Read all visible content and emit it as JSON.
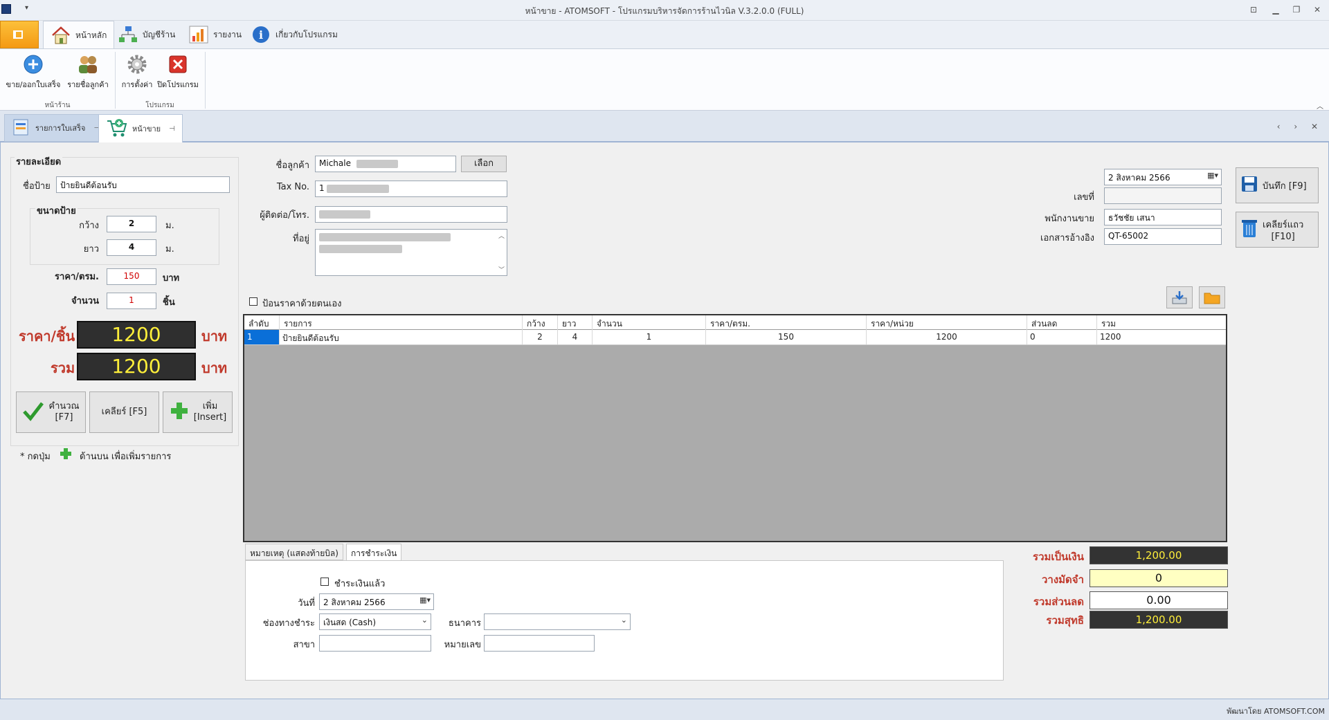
{
  "window": {
    "title": "หน้าขาย - ATOMSOFT - โปรแกรมบริหารจัดการร้านไวนิล V.3.2.0.0 (FULL)"
  },
  "ribbon": {
    "tabs": [
      {
        "label": "หน้าหลัก",
        "icon": "home-icon"
      },
      {
        "label": "บัญชีร้าน",
        "icon": "network-icon"
      },
      {
        "label": "รายงาน",
        "icon": "chart-icon"
      },
      {
        "label": "เกี่ยวกับโปรแกรม",
        "icon": "info-icon"
      }
    ],
    "buttons": {
      "sell": "ขาย/ออกใบเสร็จ",
      "customers": "รายชื่อลูกค้า",
      "settings": "การตั้งค่า",
      "close": "ปิดโปรแกรม"
    },
    "groups": {
      "shop": "หน้าร้าน",
      "program": "โปรแกรม"
    }
  },
  "doc_tabs": [
    {
      "label": "รายการใบเสร็จ"
    },
    {
      "label": "หน้าขาย"
    }
  ],
  "details": {
    "group_title": "รายละเอียด",
    "sign_name_label": "ชื่อป้าย",
    "sign_name": "ป้ายยินดีต้อนรับ",
    "size_title": "ขนาดป้าย",
    "width_label": "กว้าง",
    "width": "2",
    "length_label": "ยาว",
    "length": "4",
    "unit_m": "ม.",
    "price_sqm_label": "ราคา/ตรม.",
    "price_sqm": "150",
    "baht": "บาท",
    "qty_label": "จำนวน",
    "qty": "1",
    "pieces": "ชิ้น",
    "price_per_piece_label": "ราคา/ชิ้น",
    "price_per_piece": "1200",
    "total_label": "รวม",
    "total": "1200",
    "baht_big": "บาท",
    "btn_calc": "คำนวณ\n[F7]",
    "btn_clear": "เคลียร์ [F5]",
    "btn_add": "เพิ่ม\n[Insert]",
    "hint_prefix": "* กดปุ่ม",
    "hint_suffix": "ด้านบน เพื่อเพิ่มรายการ"
  },
  "customer": {
    "name_label": "ชื่อลูกค้า",
    "name": "Michale",
    "choose_btn": "เลือก",
    "tax_label": "Tax No.",
    "tax": "1",
    "contact_label": "ผู้ติดต่อ/โทร.",
    "address_label": "ที่อยู่"
  },
  "doc": {
    "date": "2   สิงหาคม     2566",
    "number_label": "เลขที่",
    "number": "",
    "staff_label": "พนักงานขาย",
    "staff": "ธวัชชัย เสนา",
    "ref_label": "เอกสารอ้างอิง",
    "ref": "QT-65002"
  },
  "side_buttons": {
    "save": "บันทึก [F9]",
    "clear_row": "เคลียร์แถว\n[F10]"
  },
  "manual_price_label": "ป้อนราคาด้วยตนเอง",
  "grid": {
    "headers": [
      "ลำดับ",
      "รายการ",
      "กว้าง",
      "ยาว",
      "จำนวน",
      "ราคา/ตรม.",
      "ราคา/หน่วย",
      "ส่วนลด",
      "รวม"
    ],
    "rows": [
      [
        "1",
        "ป้ายยินดีต้อนรับ",
        "2",
        "4",
        "1",
        "150",
        "1200",
        "0",
        "1200"
      ]
    ]
  },
  "bottom_tabs": [
    "หมายเหตุ (แสดงท้ายบิล)",
    "การชำระเงิน"
  ],
  "payment": {
    "paid_label": "ชำระเงินแล้ว",
    "date_label": "วันที่",
    "date": "2   สิงหาคม     2566",
    "channel_label": "ช่องทางชำระ",
    "channel": "เงินสด (Cash)",
    "bank_label": "ธนาคาร",
    "bank": "",
    "branch_label": "สาขา",
    "branch": "",
    "number_label": "หมายเลข",
    "number": ""
  },
  "summary": {
    "subtotal_label": "รวมเป็นเงิน",
    "subtotal": "1,200.00",
    "deposit_label": "วางมัดจำ",
    "deposit": "0",
    "discount_label": "รวมส่วนลด",
    "discount": "0.00",
    "net_label": "รวมสุทธิ",
    "net": "1,200.00"
  },
  "status": {
    "developer": "พัฒนาโดย ATOMSOFT.COM"
  },
  "colors": {
    "accent_red": "#c0392b",
    "lcd_text": "#ffef3a",
    "selection": "#0a6fd8"
  }
}
